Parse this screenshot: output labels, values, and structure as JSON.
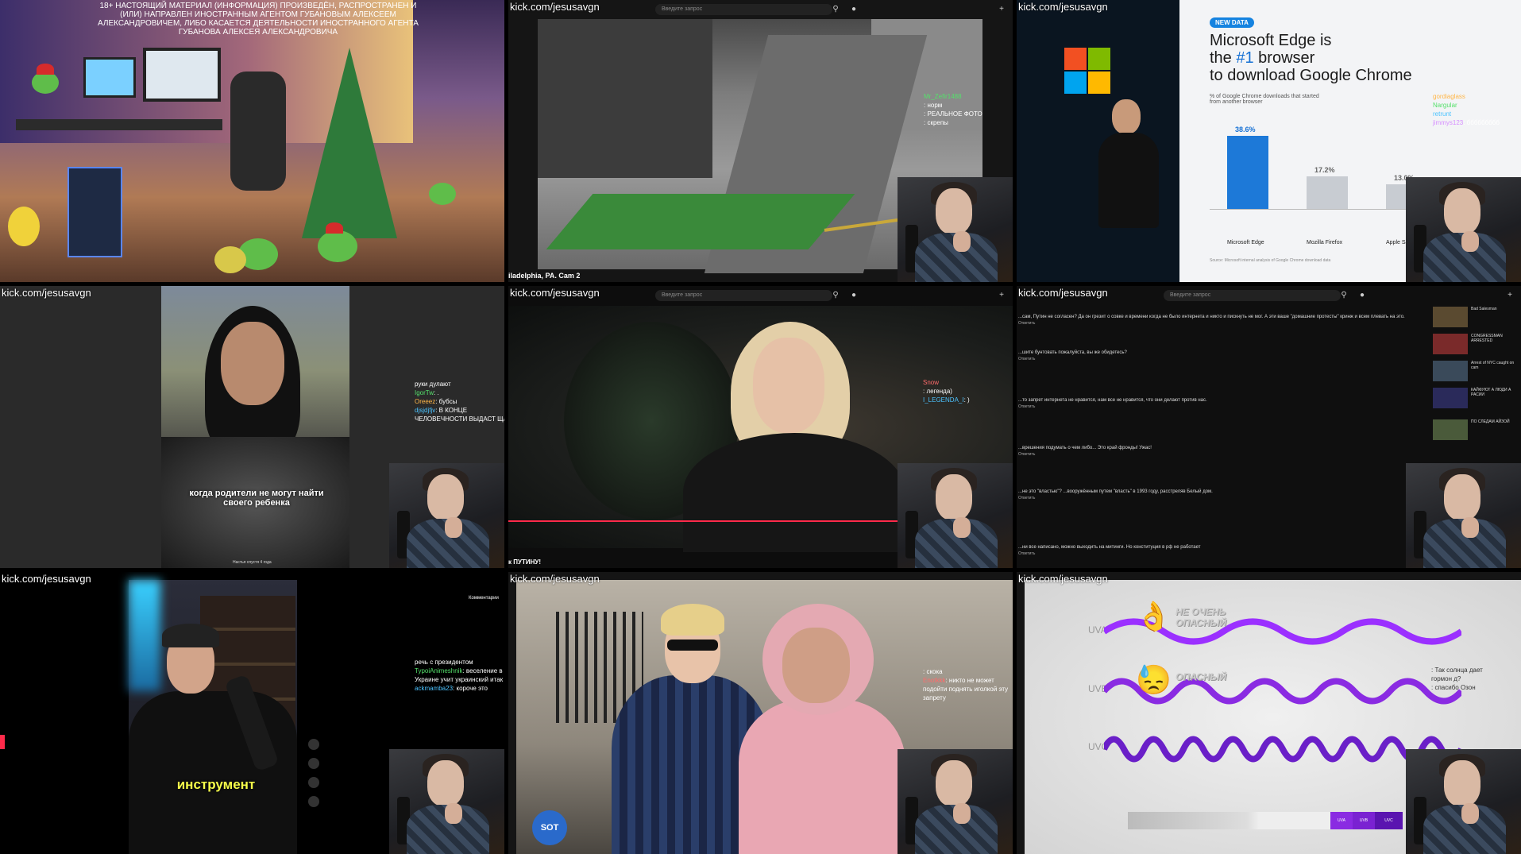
{
  "tiles": [
    {
      "url": "kick.com/jesusavgn",
      "warning": "18+ НАСТОЯЩИЙ МАТЕРИАЛ (ИНФОРМАЦИЯ) ПРОИЗВЕДЁН, РАСПРОСТРАНЕН И (ИЛИ) НАПРАВЛЕН ИНОСТРАННЫМ АГЕНТОМ ГУБАНОВЫМ АЛЕКСЕЕМ АЛЕКСАНДРОВИЧЕМ, ЛИБО КАСАЕТСЯ ДЕЯТЕЛЬНОСТИ ИНОСТРАННОГО АГЕНТА ГУБАНОВА АЛЕКСЕЯ АЛЕКСАНДРОВИЧА"
    },
    {
      "url": "kick.com/jesusavgn",
      "search_placeholder": "Введите запрос",
      "caption": "iladelphia, PA. Cam 2",
      "chat": [
        {
          "name": "Mr_Zefir1488",
          "text": ""
        },
        {
          "name": "",
          "text": ": норм"
        },
        {
          "name": "",
          "text": ": РЕАЛЬНОЕ ФОТО"
        },
        {
          "name": "",
          "text": ": скрепы"
        }
      ]
    },
    {
      "url": "kick.com/jesusavgn",
      "slide_badge": "NEW DATA",
      "slide_title_1": "Microsoft Edge is",
      "slide_title_2a": "the ",
      "slide_title_2b": "#1",
      "slide_title_2c": " browser",
      "slide_title_3": "to download Google Chrome",
      "slide_sub": "% of Google Chrome downloads that started from another browser",
      "slide_footnote": "Source: Microsoft internal analysis of Google Chrome download data",
      "bars": [
        {
          "label": "38.6%",
          "name": "Microsoft Edge",
          "value": 38.6,
          "color": "#1d79d8"
        },
        {
          "label": "17.2%",
          "name": "Mozilla Firefox",
          "value": 17.2,
          "color": "#c8ccd2"
        },
        {
          "label": "13.0%",
          "name": "Apple Safari",
          "value": 13.0,
          "color": "#c8ccd2"
        }
      ],
      "chat": [
        {
          "name": "gordiaglass",
          "text": ""
        },
        {
          "name": "Nargular",
          "text": ""
        },
        {
          "name": "retrunt",
          "text": ""
        },
        {
          "name": "jimmys123",
          "text": ": ббббббббб"
        }
      ]
    },
    {
      "url": "kick.com/jesusavgn",
      "subtitle": "когда родители не могут найти своего ребенка",
      "tiny": "Настья спустя 4 года",
      "chat": [
        {
          "name": "",
          "text": "руки дулают"
        },
        {
          "name": "IgorTw",
          "text": ": ."
        },
        {
          "name": "Oreeez",
          "text": ": бубсы"
        },
        {
          "name": "djsjdjfjv",
          "text": ": В КОНЦЕ"
        },
        {
          "name": "",
          "text": "ЧЕЛОВЕЧНОСТИ ВЫДАСТ ЩА"
        }
      ]
    },
    {
      "url": "kick.com/jesusavgn",
      "search_placeholder": "Введите запрос",
      "caption": "к ПУТИНУ!",
      "chat": [
        {
          "name": "Snow",
          "text": ""
        },
        {
          "name": "",
          "text": ""
        },
        {
          "name": "",
          "text": ": легенда)"
        },
        {
          "name": "I_LEGENDA_I",
          "text": ": )"
        }
      ]
    },
    {
      "url": "kick.com/jesusavgn",
      "search_placeholder": "Введите запрос",
      "comments": [
        {
          "text": "...сам, Путин не согласен? Да он грезит о совке и времени когда не было интернета и никто и пискнуть не мог. А эти ваше \"домашние протесты\" кринж и всем плевать на это.",
          "reply": "Ответить"
        },
        {
          "text": "...шите бунтовать пожалуйста, вы же обидетесь?",
          "reply": "Ответить"
        },
        {
          "text": "...то запрет интернета не нравится, нам все не нравится, что они делают против нас.",
          "reply": "Ответить"
        },
        {
          "text": "...врешения подумать о чем либо... Это край фронды! Ужас!",
          "reply": "Ответить"
        },
        {
          "text": "...не это \"властью\"? ...вооружённым путем \"власть\" в 1993 году, расстреляв Белый дом.",
          "reply": "Ответить"
        },
        {
          "text": "...ни все написано, можно выходить на митинги. Но конституция в рф не работает",
          "reply": "Ответить"
        }
      ],
      "sidebar": [
        {
          "title": "Bad Salesman"
        },
        {
          "title": "CONGRESSMAN ARRESTED"
        },
        {
          "title": "Arrest of NYC caught on cam"
        },
        {
          "title": "КАЙФУЮТ А ЛЮДИ А РАСИИ"
        },
        {
          "title": "ПО СЛЕДАМ АЙЗОЙ"
        }
      ]
    },
    {
      "url": "kick.com/jesusavgn",
      "caption": "инструмент",
      "comments_label": "Комментарии",
      "chat": [
        {
          "name": "",
          "text": "речь с президентом"
        },
        {
          "name": "TypoiAnimeshnik",
          "text": ": веселение в"
        },
        {
          "name": "",
          "text": "Украине учит украинский итак"
        },
        {
          "name": "ackmamba23",
          "text": ": короче это"
        }
      ]
    },
    {
      "url": "kick.com/jesusavgn",
      "sot": "SOT",
      "chat": [
        {
          "name": "",
          "text": ": скока"
        },
        {
          "name": "Enotkkk",
          "text": ": никто не может"
        },
        {
          "name": "",
          "text": "подойти поднять иголкой эту"
        },
        {
          "name": "",
          "text": "запрету"
        }
      ]
    },
    {
      "url": "kick.com/jesusavgn",
      "uva": "UVA",
      "uvb": "UVB",
      "uvc": "UVC",
      "tag_a": "НЕ ОЧЕНЬ ОПАСНЫЙ",
      "tag_b": "ОПАСНЫЙ",
      "spec": [
        "UVA",
        "UVB",
        "UVC"
      ],
      "chat": [
        {
          "name": "",
          "text": ""
        },
        {
          "name": "",
          "text": ": Так солнца дает"
        },
        {
          "name": "",
          "text": "гормон д?"
        },
        {
          "name": "",
          "text": ": спасибо Озон"
        }
      ]
    }
  ],
  "colors": {
    "accent_red": "#ff2a4a",
    "edge_blue": "#1d79d8",
    "uv_purple": "#8a2be2"
  }
}
